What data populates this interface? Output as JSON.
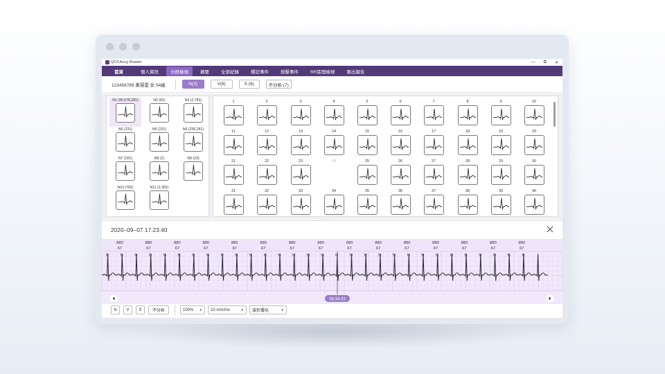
{
  "app": {
    "title": "QOCAecg Reader",
    "window_controls": [
      "—",
      "⧉",
      "✕"
    ]
  },
  "menu": [
    {
      "label": "首頁",
      "active": false
    },
    {
      "label": "個人資訊",
      "active": false
    },
    {
      "label": "分群檢視",
      "active": true
    },
    {
      "label": "摘要",
      "active": false
    },
    {
      "label": "全部紀錄",
      "active": false
    },
    {
      "label": "標記事件",
      "active": false
    },
    {
      "label": "按壓事件",
      "active": false
    },
    {
      "label": "RR區間檢視",
      "active": false
    },
    {
      "label": "匯出報告",
      "active": false
    }
  ],
  "patient": {
    "info": "123456789  黃慧雲  女  54歲"
  },
  "filters": [
    {
      "label": "N(3)",
      "active": true
    },
    {
      "label": "V(6)",
      "active": false
    },
    {
      "label": "S (6)",
      "active": false
    },
    {
      "label": "不分析 (7)",
      "active": false
    }
  ],
  "clusters": [
    {
      "label": "N1 (45,678,281)",
      "selected": true
    },
    {
      "label": "N2 (81)",
      "selected": false
    },
    {
      "label": "N3 (2,781)",
      "selected": false
    },
    {
      "label": "N5 (231)",
      "selected": false
    },
    {
      "label": "N5 (231)",
      "selected": false
    },
    {
      "label": "N6 (236,281)",
      "selected": false
    },
    {
      "label": "N7 (281)",
      "selected": false
    },
    {
      "label": "N8 (2)",
      "selected": false
    },
    {
      "label": "N9 (23)",
      "selected": false
    },
    {
      "label": "N10 (782)",
      "selected": false
    },
    {
      "label": "N11 (2,381)",
      "selected": false
    }
  ],
  "beats": [
    "1",
    "2",
    "3",
    "4",
    "5",
    "6",
    "7",
    "8",
    "9",
    "10",
    "11",
    "12",
    "13",
    "14",
    "15",
    "16",
    "17",
    "18",
    "19",
    "20",
    "21",
    "22",
    "23",
    "24",
    "25",
    "26",
    "27",
    "28",
    "29",
    "30",
    "31",
    "32",
    "33",
    "34",
    "35",
    "36",
    "37",
    "38",
    "39",
    "40"
  ],
  "detail": {
    "timestamp": "2020–09–07 17:23:40",
    "cursor_time": "08:34:33",
    "beat_annotations": [
      {
        "top": "880",
        "bottom": "67"
      },
      {
        "top": "880",
        "bottom": "67"
      },
      {
        "top": "880",
        "bottom": "67"
      },
      {
        "top": "880",
        "bottom": "67"
      },
      {
        "top": "880",
        "bottom": "67"
      },
      {
        "top": "880",
        "bottom": "67"
      },
      {
        "top": "880",
        "bottom": "67"
      },
      {
        "top": "880",
        "bottom": "67"
      },
      {
        "top": "880",
        "bottom": "67"
      },
      {
        "top": "880",
        "bottom": "67"
      },
      {
        "top": "880",
        "bottom": "67"
      },
      {
        "top": "880",
        "bottom": "67"
      },
      {
        "top": "880",
        "bottom": "67"
      },
      {
        "top": "880",
        "bottom": "67"
      },
      {
        "top": "880",
        "bottom": "67"
      }
    ],
    "beat_types": [
      "N",
      "N",
      "N",
      "N",
      "N",
      "N",
      "N",
      "N",
      "N",
      "N",
      "N",
      "N",
      "N",
      "N",
      "N",
      "N",
      "N",
      "N",
      "N",
      "N",
      "N",
      "N",
      "N",
      "N",
      "N",
      "N",
      "N",
      "N",
      "N",
      "N"
    ]
  },
  "toolbar": {
    "btn_n": "N",
    "btn_v": "V",
    "btn_s": "S",
    "btn_unanalyzed": "不分析",
    "zoom": "100%",
    "gain": "10 mm/mv",
    "filter": "波形優化"
  },
  "colors": {
    "menu_bg": "#523a78",
    "accent": "#9b7cc7",
    "grid_bg": "#f1e9fb",
    "grid_line": "#d9c8ef",
    "ecg_trace": "#2b2633"
  }
}
